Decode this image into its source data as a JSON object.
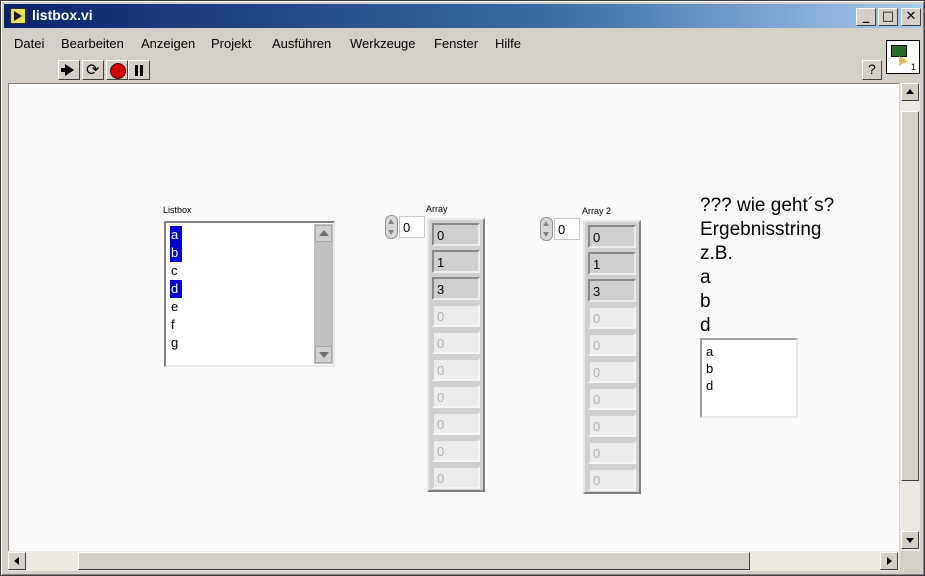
{
  "window": {
    "title": "listbox.vi",
    "controls": {
      "minimize": "_",
      "maximize": "□",
      "close": "✕"
    }
  },
  "menu": {
    "items": [
      "Datei",
      "Bearbeiten",
      "Anzeigen",
      "Projekt",
      "Ausführen",
      "Werkzeuge",
      "Fenster",
      "Hilfe"
    ]
  },
  "toolbar": {
    "buttons": [
      "run-arrow-icon",
      "run-continuously-icon",
      "abort-icon",
      "pause-icon"
    ],
    "help": "?",
    "vi_icon_number": "1"
  },
  "listbox": {
    "label": "Listbox",
    "items": [
      {
        "text": "a",
        "selected": true
      },
      {
        "text": "b",
        "selected": true
      },
      {
        "text": "c",
        "selected": false
      },
      {
        "text": "d",
        "selected": true
      },
      {
        "text": "e",
        "selected": false
      },
      {
        "text": "f",
        "selected": false
      },
      {
        "text": "g",
        "selected": false
      }
    ]
  },
  "array1": {
    "label": "Array",
    "index": "0",
    "values": [
      "0",
      "1",
      "3"
    ],
    "empty_value": "0"
  },
  "array2": {
    "label": "Array 2",
    "index": "0",
    "values": [
      "0",
      "1",
      "3"
    ],
    "empty_value": "0"
  },
  "annotation": {
    "lines": [
      "??? wie geht´s?",
      "Ergebnisstring",
      "z.B.",
      "a",
      "b",
      "d"
    ]
  },
  "result_string": {
    "lines": [
      "a",
      "b",
      "d"
    ]
  }
}
